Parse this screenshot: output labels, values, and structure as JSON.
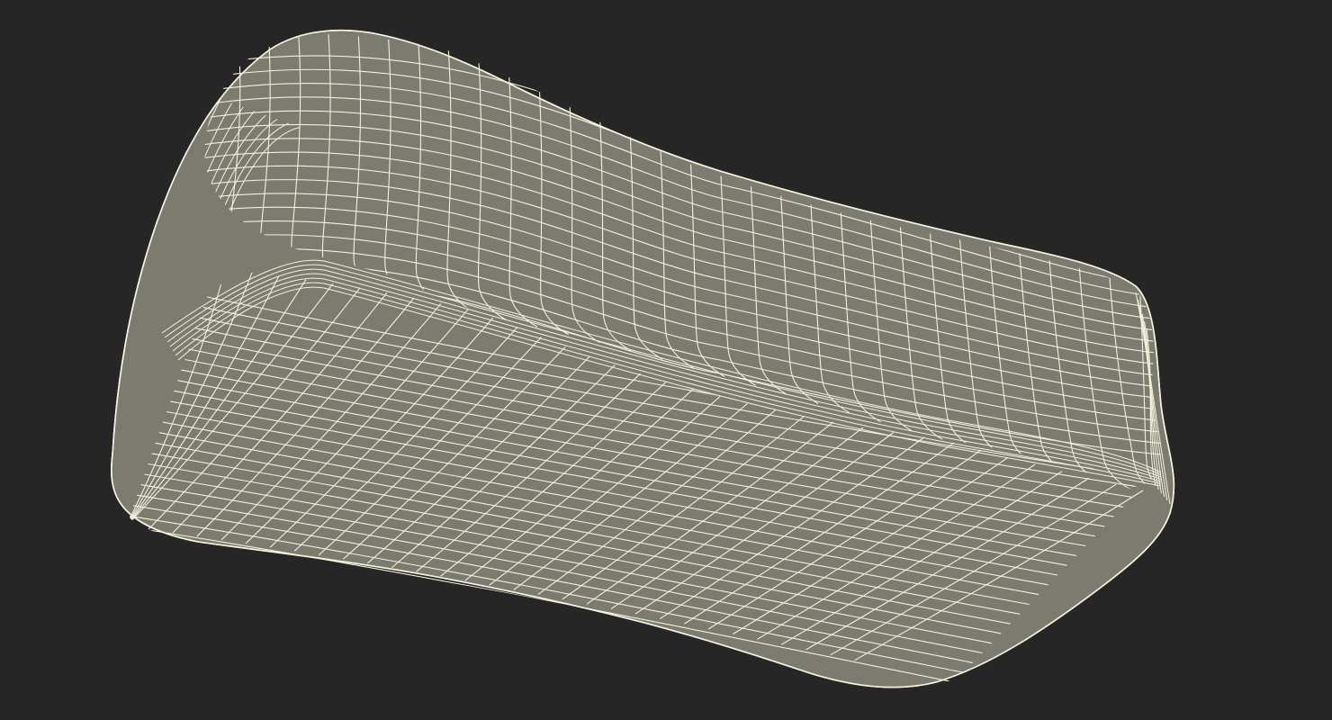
{
  "viewport": {
    "background_color": "#262626",
    "model": {
      "name": "wireframe-mesh-model",
      "fill_color": "#7b7b6f",
      "wire_color": "#f4f1dc"
    }
  }
}
